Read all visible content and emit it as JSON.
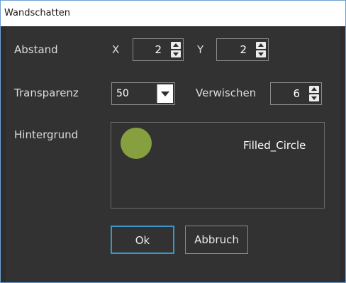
{
  "window": {
    "title": "Wandschatten"
  },
  "abstand": {
    "label": "Abstand",
    "x_label": "X",
    "x_value": "2",
    "y_label": "Y",
    "y_value": "2"
  },
  "transparenz": {
    "label": "Transparenz",
    "value": "50"
  },
  "verwischen": {
    "label": "Verwischen",
    "value": "6"
  },
  "hintergrund": {
    "label": "Hintergrund",
    "shape_name": "Filled_Circle",
    "shape_color": "#86a03f"
  },
  "buttons": {
    "ok": "Ok",
    "cancel": "Abbruch"
  },
  "colors": {
    "background": "#323232",
    "accent": "#3d95c7",
    "text": "#dcdcdc"
  },
  "icons": {
    "spin_up": "arrow-up-icon",
    "spin_down": "arrow-down-icon",
    "dropdown": "chevron-down-icon"
  }
}
